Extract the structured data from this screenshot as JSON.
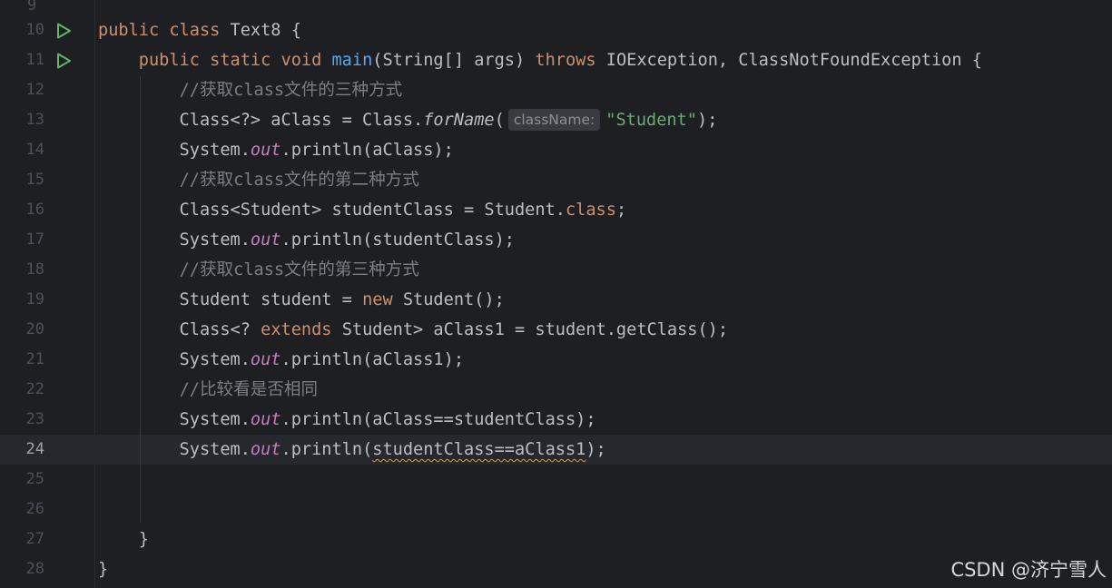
{
  "editor": {
    "partial_top_line_number": "9",
    "lines": [
      {
        "n": "10",
        "run": true,
        "segments": [
          [
            "kw",
            "public class "
          ],
          [
            "p",
            "Text8 {"
          ]
        ]
      },
      {
        "n": "11",
        "run": true,
        "segments": [
          [
            "p",
            "    "
          ],
          [
            "kw",
            "public static void "
          ],
          [
            "fn",
            "main"
          ],
          [
            "p",
            "(String[] args) "
          ],
          [
            "kw",
            "throws "
          ],
          [
            "p",
            "IOException, ClassNotFoundException {"
          ]
        ]
      },
      {
        "n": "12",
        "segments": [
          [
            "p",
            "        "
          ],
          [
            "cm",
            "//获取class文件的三种方式"
          ]
        ]
      },
      {
        "n": "13",
        "segments": [
          [
            "p",
            "        Class<?> aClass = Class."
          ],
          [
            "it",
            "forName"
          ],
          [
            "p",
            "("
          ],
          [
            "hint",
            "className:"
          ],
          [
            "str",
            "\"Student\""
          ],
          [
            "p",
            ");"
          ]
        ]
      },
      {
        "n": "14",
        "segments": [
          [
            "p",
            "        System."
          ],
          [
            "st",
            "out"
          ],
          [
            "p",
            ".println(aClass);"
          ]
        ]
      },
      {
        "n": "15",
        "segments": [
          [
            "p",
            "        "
          ],
          [
            "cm",
            "//获取class文件的第二种方式"
          ]
        ]
      },
      {
        "n": "16",
        "segments": [
          [
            "p",
            "        Class<Student> studentClass = Student."
          ],
          [
            "kw",
            "class"
          ],
          [
            "p",
            ";"
          ]
        ]
      },
      {
        "n": "17",
        "segments": [
          [
            "p",
            "        System."
          ],
          [
            "st",
            "out"
          ],
          [
            "p",
            ".println(studentClass);"
          ]
        ]
      },
      {
        "n": "18",
        "segments": [
          [
            "p",
            "        "
          ],
          [
            "cm",
            "//获取class文件的第三种方式"
          ]
        ]
      },
      {
        "n": "19",
        "segments": [
          [
            "p",
            "        Student student = "
          ],
          [
            "kw",
            "new "
          ],
          [
            "p",
            "Student();"
          ]
        ]
      },
      {
        "n": "20",
        "segments": [
          [
            "p",
            "        Class<? "
          ],
          [
            "kw",
            "extends "
          ],
          [
            "p",
            "Student> aClass1 = student.getClass();"
          ]
        ]
      },
      {
        "n": "21",
        "segments": [
          [
            "p",
            "        System."
          ],
          [
            "st",
            "out"
          ],
          [
            "p",
            ".println(aClass1);"
          ]
        ]
      },
      {
        "n": "22",
        "segments": [
          [
            "p",
            "        "
          ],
          [
            "cm",
            "//比较看是否相同"
          ]
        ]
      },
      {
        "n": "23",
        "segments": [
          [
            "p",
            "        System."
          ],
          [
            "st",
            "out"
          ],
          [
            "p",
            ".println(aClass==studentClass);"
          ]
        ]
      },
      {
        "n": "24",
        "current": true,
        "segments": [
          [
            "p",
            "        System."
          ],
          [
            "st",
            "out"
          ],
          [
            "p",
            ".println("
          ],
          [
            "warn",
            "studentClass==aClass1"
          ],
          [
            "p",
            ");"
          ]
        ]
      },
      {
        "n": "25",
        "segments": []
      },
      {
        "n": "26",
        "segments": []
      },
      {
        "n": "27",
        "segments": [
          [
            "p",
            "    }"
          ]
        ]
      },
      {
        "n": "28",
        "segments": [
          [
            "p",
            "}"
          ]
        ]
      }
    ]
  },
  "icons": {
    "run_gutter": "run-triangle-icon"
  },
  "colors": {
    "background": "#1e1f22",
    "current_line": "#26282e",
    "keyword": "#cf8e6d",
    "method_decl": "#56a8f5",
    "static_field": "#c77dbb",
    "string": "#6aab73",
    "comment": "#7a7e85",
    "run_icon": "#5fb865"
  },
  "watermark": "CSDN @济宁雪人"
}
